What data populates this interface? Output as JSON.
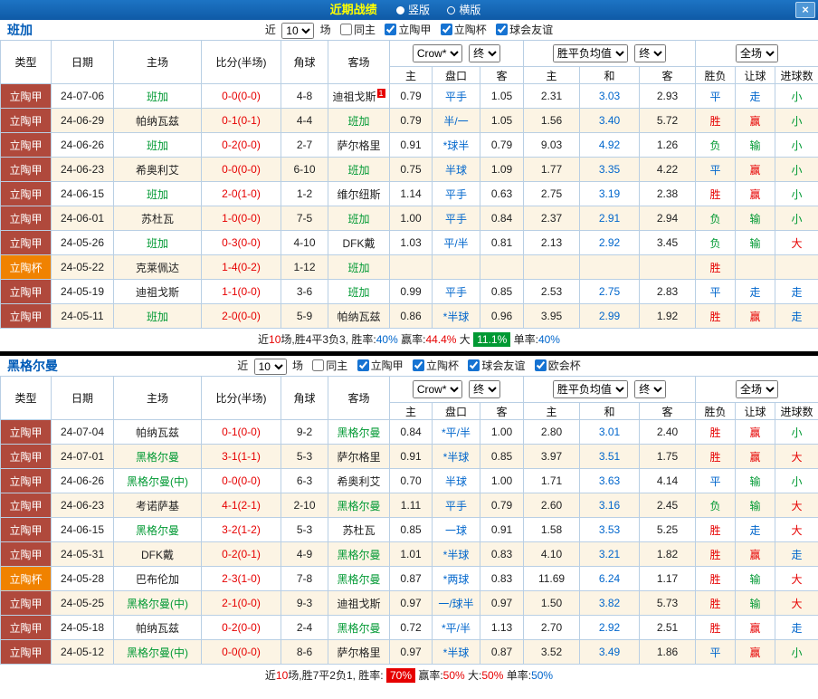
{
  "titlebar": {
    "title": "近期战绩",
    "radio_vertical": "竖版",
    "radio_horizontal": "横版",
    "close": "×"
  },
  "sections": [
    {
      "team": "班加",
      "filter": {
        "jin": "近",
        "games": "10",
        "chang": "场",
        "checkboxes": [
          {
            "label": "同主",
            "checked": false
          },
          {
            "label": "立陶甲",
            "checked": true
          },
          {
            "label": "立陶杯",
            "checked": true
          },
          {
            "label": "球会友谊",
            "checked": true
          }
        ]
      },
      "header": {
        "cols": [
          "类型",
          "日期",
          "主场",
          "比分(半场)",
          "角球",
          "客场"
        ],
        "odds_select": "Crow*",
        "odds_final": "终",
        "europe_select": "胜平负均值",
        "europe_final": "终",
        "result_select": "全场",
        "sub": [
          "主",
          "盘口",
          "客",
          "主",
          "和",
          "客",
          "胜负",
          "让球",
          "进球数"
        ]
      },
      "rows": [
        {
          "type": "立陶甲",
          "typeClass": "league",
          "date": "24-07-06",
          "home": "班加",
          "homeFocal": true,
          "score": "0-0(0-0)",
          "corner": "4-8",
          "away": "迪祖戈斯",
          "awayFocal": false,
          "awayBadge": "1",
          "odds": [
            "0.79",
            "平手",
            "1.05"
          ],
          "europe": [
            "2.31",
            "3.03",
            "2.93"
          ],
          "results": [
            "平",
            "走",
            "小"
          ]
        },
        {
          "type": "立陶甲",
          "typeClass": "league",
          "date": "24-06-29",
          "home": "帕纳瓦兹",
          "homeFocal": false,
          "score": "0-1(0-1)",
          "corner": "4-4",
          "away": "班加",
          "awayFocal": true,
          "odds": [
            "0.79",
            "半/一",
            "1.05"
          ],
          "europe": [
            "1.56",
            "3.40",
            "5.72"
          ],
          "results": [
            "胜",
            "赢",
            "小"
          ]
        },
        {
          "type": "立陶甲",
          "typeClass": "league",
          "date": "24-06-26",
          "home": "班加",
          "homeFocal": true,
          "score": "0-2(0-0)",
          "corner": "2-7",
          "away": "萨尔格里",
          "awayFocal": false,
          "odds": [
            "0.91",
            "*球半",
            "0.79"
          ],
          "europe": [
            "9.03",
            "4.92",
            "1.26"
          ],
          "results": [
            "负",
            "输",
            "小"
          ]
        },
        {
          "type": "立陶甲",
          "typeClass": "league",
          "date": "24-06-23",
          "home": "希奥利艾",
          "homeFocal": false,
          "score": "0-0(0-0)",
          "corner": "6-10",
          "away": "班加",
          "awayFocal": true,
          "odds": [
            "0.75",
            "半球",
            "1.09"
          ],
          "europe": [
            "1.77",
            "3.35",
            "4.22"
          ],
          "results": [
            "平",
            "赢",
            "小"
          ]
        },
        {
          "type": "立陶甲",
          "typeClass": "league",
          "date": "24-06-15",
          "home": "班加",
          "homeFocal": true,
          "score": "2-0(1-0)",
          "corner": "1-2",
          "away": "维尔纽斯",
          "awayFocal": false,
          "odds": [
            "1.14",
            "平手",
            "0.63"
          ],
          "europe": [
            "2.75",
            "3.19",
            "2.38"
          ],
          "results": [
            "胜",
            "赢",
            "小"
          ]
        },
        {
          "type": "立陶甲",
          "typeClass": "league",
          "date": "24-06-01",
          "home": "苏杜瓦",
          "homeFocal": false,
          "score": "1-0(0-0)",
          "corner": "7-5",
          "away": "班加",
          "awayFocal": true,
          "odds": [
            "1.00",
            "平手",
            "0.84"
          ],
          "europe": [
            "2.37",
            "2.91",
            "2.94"
          ],
          "results": [
            "负",
            "输",
            "小"
          ]
        },
        {
          "type": "立陶甲",
          "typeClass": "league",
          "date": "24-05-26",
          "home": "班加",
          "homeFocal": true,
          "score": "0-3(0-0)",
          "corner": "4-10",
          "away": "DFK戴",
          "awayFocal": false,
          "odds": [
            "1.03",
            "平/半",
            "0.81"
          ],
          "europe": [
            "2.13",
            "2.92",
            "3.45"
          ],
          "results": [
            "负",
            "输",
            "大"
          ]
        },
        {
          "type": "立陶杯",
          "typeClass": "cup",
          "date": "24-05-22",
          "home": "克莱佩达",
          "homeFocal": false,
          "score": "1-4(0-2)",
          "corner": "1-12",
          "away": "班加",
          "awayFocal": true,
          "odds": [
            "",
            "",
            ""
          ],
          "europe": [
            "",
            "",
            ""
          ],
          "results": [
            "胜",
            "",
            ""
          ]
        },
        {
          "type": "立陶甲",
          "typeClass": "league",
          "date": "24-05-19",
          "home": "迪祖戈斯",
          "homeFocal": false,
          "score": "1-1(0-0)",
          "corner": "3-6",
          "away": "班加",
          "awayFocal": true,
          "odds": [
            "0.99",
            "平手",
            "0.85"
          ],
          "europe": [
            "2.53",
            "2.75",
            "2.83"
          ],
          "results": [
            "平",
            "走",
            "走"
          ]
        },
        {
          "type": "立陶甲",
          "typeClass": "league",
          "date": "24-05-11",
          "home": "班加",
          "homeFocal": true,
          "score": "2-0(0-0)",
          "corner": "5-9",
          "away": "帕纳瓦兹",
          "awayFocal": false,
          "odds": [
            "0.86",
            "*半球",
            "0.96"
          ],
          "europe": [
            "3.95",
            "2.99",
            "1.92"
          ],
          "results": [
            "胜",
            "赢",
            "走"
          ]
        }
      ],
      "summary": [
        {
          "t": "近"
        },
        {
          "t": "10",
          "c": "r"
        },
        {
          "t": "场,胜4平3负3, 胜率:"
        },
        {
          "t": "40%",
          "c": "b"
        },
        {
          "t": " 赢率:"
        },
        {
          "t": "44.4%",
          "c": "r"
        },
        {
          "t": " 大 "
        },
        {
          "t": "11.1%",
          "bg": "g"
        },
        {
          "t": " 单率:"
        },
        {
          "t": "40%",
          "c": "b"
        }
      ]
    },
    {
      "team": "黑格尔曼",
      "filter": {
        "jin": "近",
        "games": "10",
        "chang": "场",
        "checkboxes": [
          {
            "label": "同主",
            "checked": false
          },
          {
            "label": "立陶甲",
            "checked": true
          },
          {
            "label": "立陶杯",
            "checked": true
          },
          {
            "label": "球会友谊",
            "checked": true
          },
          {
            "label": "欧会杯",
            "checked": true
          }
        ]
      },
      "header": {
        "cols": [
          "类型",
          "日期",
          "主场",
          "比分(半场)",
          "角球",
          "客场"
        ],
        "odds_select": "Crow*",
        "odds_final": "终",
        "europe_select": "胜平负均值",
        "europe_final": "终",
        "result_select": "全场",
        "sub": [
          "主",
          "盘口",
          "客",
          "主",
          "和",
          "客",
          "胜负",
          "让球",
          "进球数"
        ]
      },
      "rows": [
        {
          "type": "立陶甲",
          "typeClass": "league",
          "date": "24-07-04",
          "home": "帕纳瓦兹",
          "homeFocal": false,
          "score": "0-1(0-0)",
          "corner": "9-2",
          "away": "黑格尔曼",
          "awayFocal": true,
          "odds": [
            "0.84",
            "*平/半",
            "1.00"
          ],
          "europe": [
            "2.80",
            "3.01",
            "2.40"
          ],
          "results": [
            "胜",
            "赢",
            "小"
          ]
        },
        {
          "type": "立陶甲",
          "typeClass": "league",
          "date": "24-07-01",
          "home": "黑格尔曼",
          "homeFocal": true,
          "score": "3-1(1-1)",
          "corner": "5-3",
          "away": "萨尔格里",
          "awayFocal": false,
          "odds": [
            "0.91",
            "*半球",
            "0.85"
          ],
          "europe": [
            "3.97",
            "3.51",
            "1.75"
          ],
          "results": [
            "胜",
            "赢",
            "大"
          ]
        },
        {
          "type": "立陶甲",
          "typeClass": "league",
          "date": "24-06-26",
          "home": "黑格尔曼(中)",
          "homeFocal": true,
          "score": "0-0(0-0)",
          "corner": "6-3",
          "away": "希奥利艾",
          "awayFocal": false,
          "odds": [
            "0.70",
            "半球",
            "1.00"
          ],
          "europe": [
            "1.71",
            "3.63",
            "4.14"
          ],
          "results": [
            "平",
            "输",
            "小"
          ]
        },
        {
          "type": "立陶甲",
          "typeClass": "league",
          "date": "24-06-23",
          "home": "考诺萨基",
          "homeFocal": false,
          "score": "4-1(2-1)",
          "corner": "2-10",
          "away": "黑格尔曼",
          "awayFocal": true,
          "odds": [
            "1.11",
            "平手",
            "0.79"
          ],
          "europe": [
            "2.60",
            "3.16",
            "2.45"
          ],
          "results": [
            "负",
            "输",
            "大"
          ]
        },
        {
          "type": "立陶甲",
          "typeClass": "league",
          "date": "24-06-15",
          "home": "黑格尔曼",
          "homeFocal": true,
          "score": "3-2(1-2)",
          "corner": "5-3",
          "away": "苏杜瓦",
          "awayFocal": false,
          "odds": [
            "0.85",
            "一球",
            "0.91"
          ],
          "europe": [
            "1.58",
            "3.53",
            "5.25"
          ],
          "results": [
            "胜",
            "走",
            "大"
          ]
        },
        {
          "type": "立陶甲",
          "typeClass": "league",
          "date": "24-05-31",
          "home": "DFK戴",
          "homeFocal": false,
          "score": "0-2(0-1)",
          "corner": "4-9",
          "away": "黑格尔曼",
          "awayFocal": true,
          "odds": [
            "1.01",
            "*半球",
            "0.83"
          ],
          "europe": [
            "4.10",
            "3.21",
            "1.82"
          ],
          "results": [
            "胜",
            "赢",
            "走"
          ]
        },
        {
          "type": "立陶杯",
          "typeClass": "cup",
          "date": "24-05-28",
          "home": "巴布伦加",
          "homeFocal": false,
          "score": "2-3(1-0)",
          "corner": "7-8",
          "away": "黑格尔曼",
          "awayFocal": true,
          "odds": [
            "0.87",
            "*两球",
            "0.83"
          ],
          "europe": [
            "11.69",
            "6.24",
            "1.17"
          ],
          "results": [
            "胜",
            "输",
            "大"
          ]
        },
        {
          "type": "立陶甲",
          "typeClass": "league",
          "date": "24-05-25",
          "home": "黑格尔曼(中)",
          "homeFocal": true,
          "score": "2-1(0-0)",
          "corner": "9-3",
          "away": "迪祖戈斯",
          "awayFocal": false,
          "odds": [
            "0.97",
            "一/球半",
            "0.97"
          ],
          "europe": [
            "1.50",
            "3.82",
            "5.73"
          ],
          "results": [
            "胜",
            "输",
            "大"
          ]
        },
        {
          "type": "立陶甲",
          "typeClass": "league",
          "date": "24-05-18",
          "home": "帕纳瓦兹",
          "homeFocal": false,
          "score": "0-2(0-0)",
          "corner": "2-4",
          "away": "黑格尔曼",
          "awayFocal": true,
          "odds": [
            "0.72",
            "*平/半",
            "1.13"
          ],
          "europe": [
            "2.70",
            "2.92",
            "2.51"
          ],
          "results": [
            "胜",
            "赢",
            "走"
          ]
        },
        {
          "type": "立陶甲",
          "typeClass": "league",
          "date": "24-05-12",
          "home": "黑格尔曼(中)",
          "homeFocal": true,
          "score": "0-0(0-0)",
          "corner": "8-6",
          "away": "萨尔格里",
          "awayFocal": false,
          "odds": [
            "0.97",
            "*半球",
            "0.87"
          ],
          "europe": [
            "3.52",
            "3.49",
            "1.86"
          ],
          "results": [
            "平",
            "赢",
            "小"
          ]
        }
      ],
      "summary": [
        {
          "t": "近"
        },
        {
          "t": "10",
          "c": "r"
        },
        {
          "t": "场,胜7平2负1, 胜率: "
        },
        {
          "t": "70%",
          "bg": "r"
        },
        {
          "t": " 赢率:"
        },
        {
          "t": "50%",
          "c": "r"
        },
        {
          "t": " 大:"
        },
        {
          "t": "50%",
          "c": "r"
        },
        {
          "t": " 单率:"
        },
        {
          "t": "50%",
          "c": "b"
        }
      ]
    }
  ]
}
